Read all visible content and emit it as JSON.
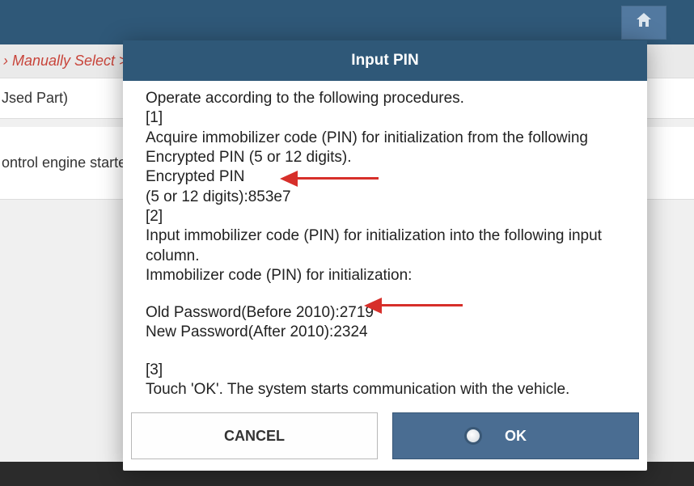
{
  "topbar": {
    "home_icon_name": "home-icon"
  },
  "breadcrumb": "› Manually Select > Fa",
  "bg": {
    "item1": "Jsed Part)",
    "item2": "ontrol engine starte"
  },
  "dialog": {
    "title": "Input PIN",
    "body": {
      "l0": "Operate according to the following procedures.",
      "l1": "[1]",
      "l2": "Acquire immobilizer code (PIN) for initialization from the following Encrypted PIN (5 or 12 digits).",
      "l3": "Encrypted PIN",
      "l4": "(5 or 12 digits):853e7",
      "l5": "[2]",
      "l6": "Input immobilizer code (PIN) for initialization into the following input column.",
      "l7": "Immobilizer code (PIN) for initialization:",
      "l8": "Old Password(Before 2010):2719",
      "l9": "New Password(After  2010):2324",
      "l10": "[3]",
      "l11": "Touch 'OK'. The system starts communication with the vehicle."
    },
    "buttons": {
      "cancel": "CANCEL",
      "ok": "OK"
    }
  },
  "data_values": {
    "encrypted_pin": "853e7",
    "old_password": "2719",
    "new_password": "2324"
  }
}
